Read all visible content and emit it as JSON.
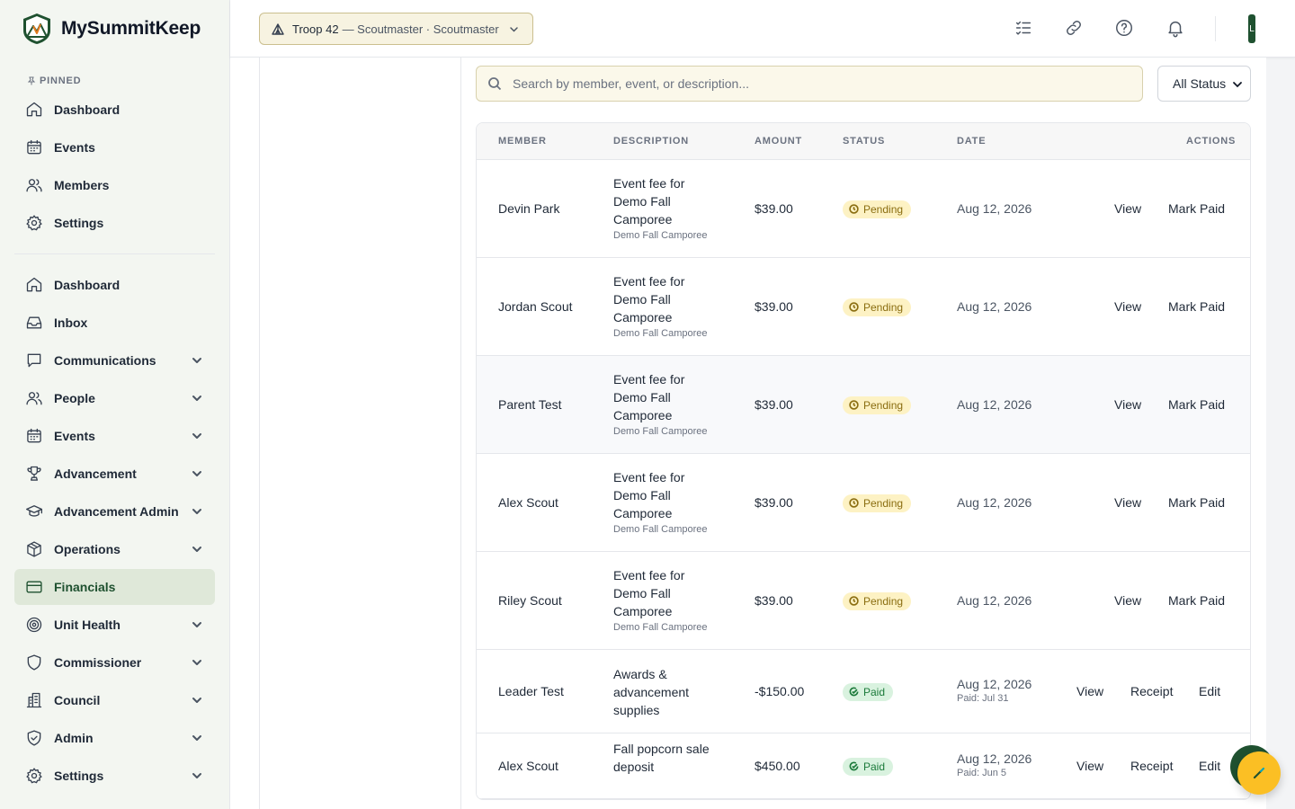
{
  "app": {
    "name": "MySummitKeep"
  },
  "sidebar": {
    "pinned_label": "PINNED",
    "pinned": [
      {
        "label": "Dashboard",
        "icon": "home-icon"
      },
      {
        "label": "Events",
        "icon": "calendar-icon"
      },
      {
        "label": "Members",
        "icon": "users-icon"
      },
      {
        "label": "Settings",
        "icon": "gear-icon"
      }
    ],
    "items": [
      {
        "label": "Dashboard",
        "icon": "home-icon",
        "expandable": false
      },
      {
        "label": "Inbox",
        "icon": "inbox-icon",
        "expandable": false
      },
      {
        "label": "Communications",
        "icon": "chat-icon",
        "expandable": true
      },
      {
        "label": "People",
        "icon": "users-icon",
        "expandable": true
      },
      {
        "label": "Events",
        "icon": "calendar-icon",
        "expandable": true
      },
      {
        "label": "Advancement",
        "icon": "trophy-icon",
        "expandable": true
      },
      {
        "label": "Advancement Admin",
        "icon": "graduation-cap-icon",
        "expandable": true
      },
      {
        "label": "Operations",
        "icon": "package-icon",
        "expandable": true
      },
      {
        "label": "Financials",
        "icon": "credit-card-icon",
        "expandable": false,
        "active": true
      },
      {
        "label": "Unit Health",
        "icon": "target-icon",
        "expandable": true
      },
      {
        "label": "Commissioner",
        "icon": "shield-icon",
        "expandable": true
      },
      {
        "label": "Council",
        "icon": "building-icon",
        "expandable": true
      },
      {
        "label": "Admin",
        "icon": "shield-check-icon",
        "expandable": true
      },
      {
        "label": "Settings",
        "icon": "gear-icon",
        "expandable": true
      }
    ]
  },
  "topbar": {
    "troop_name": "Troop 42",
    "troop_role": "— Scoutmaster · Scoutmaster",
    "avatar_initial": "L"
  },
  "filters": {
    "search_placeholder": "Search by member, event, or description...",
    "status_value": "All Status"
  },
  "table": {
    "headers": [
      "MEMBER",
      "DESCRIPTION",
      "AMOUNT",
      "STATUS",
      "DATE",
      "ACTIONS"
    ],
    "rows": [
      {
        "member": "Devin Park",
        "desc": "Event fee for Demo Fall Camporee",
        "desc_sub": "Demo Fall Camporee",
        "amount": "$39.00",
        "status": "Pending",
        "date": "Aug 12, 2026",
        "paid_on": "",
        "actions": [
          "View",
          "Mark Paid"
        ]
      },
      {
        "member": "Jordan Scout",
        "desc": "Event fee for Demo Fall Camporee",
        "desc_sub": "Demo Fall Camporee",
        "amount": "$39.00",
        "status": "Pending",
        "date": "Aug 12, 2026",
        "paid_on": "",
        "actions": [
          "View",
          "Mark Paid"
        ]
      },
      {
        "member": "Parent Test",
        "desc": "Event fee for Demo Fall Camporee",
        "desc_sub": "Demo Fall Camporee",
        "amount": "$39.00",
        "status": "Pending",
        "date": "Aug 12, 2026",
        "paid_on": "",
        "actions": [
          "View",
          "Mark Paid"
        ]
      },
      {
        "member": "Alex Scout",
        "desc": "Event fee for Demo Fall Camporee",
        "desc_sub": "Demo Fall Camporee",
        "amount": "$39.00",
        "status": "Pending",
        "date": "Aug 12, 2026",
        "paid_on": "",
        "actions": [
          "View",
          "Mark Paid"
        ]
      },
      {
        "member": "Riley Scout",
        "desc": "Event fee for Demo Fall Camporee",
        "desc_sub": "Demo Fall Camporee",
        "amount": "$39.00",
        "status": "Pending",
        "date": "Aug 12, 2026",
        "paid_on": "",
        "actions": [
          "View",
          "Mark Paid"
        ]
      },
      {
        "member": "Leader Test",
        "desc": "Awards & advancement supplies",
        "desc_sub": "",
        "amount": "-$150.00",
        "status": "Paid",
        "date": "Aug 12, 2026",
        "paid_on": "Paid: Jul 31",
        "actions": [
          "View",
          "Receipt",
          "Edit"
        ]
      },
      {
        "member": "Alex Scout",
        "desc": "Fall popcorn sale deposit",
        "desc_sub": "",
        "amount": "$450.00",
        "status": "Paid",
        "date": "Aug 12, 2026",
        "paid_on": "Paid: Jun 5",
        "actions": [
          "View",
          "Receipt",
          "Edit"
        ]
      }
    ]
  },
  "colors": {
    "accent": "#1f5130",
    "active_bg": "#dfe8d9",
    "pending": "#fdf2c4",
    "paid": "#d9f2df",
    "fab": "#fbbf24"
  }
}
